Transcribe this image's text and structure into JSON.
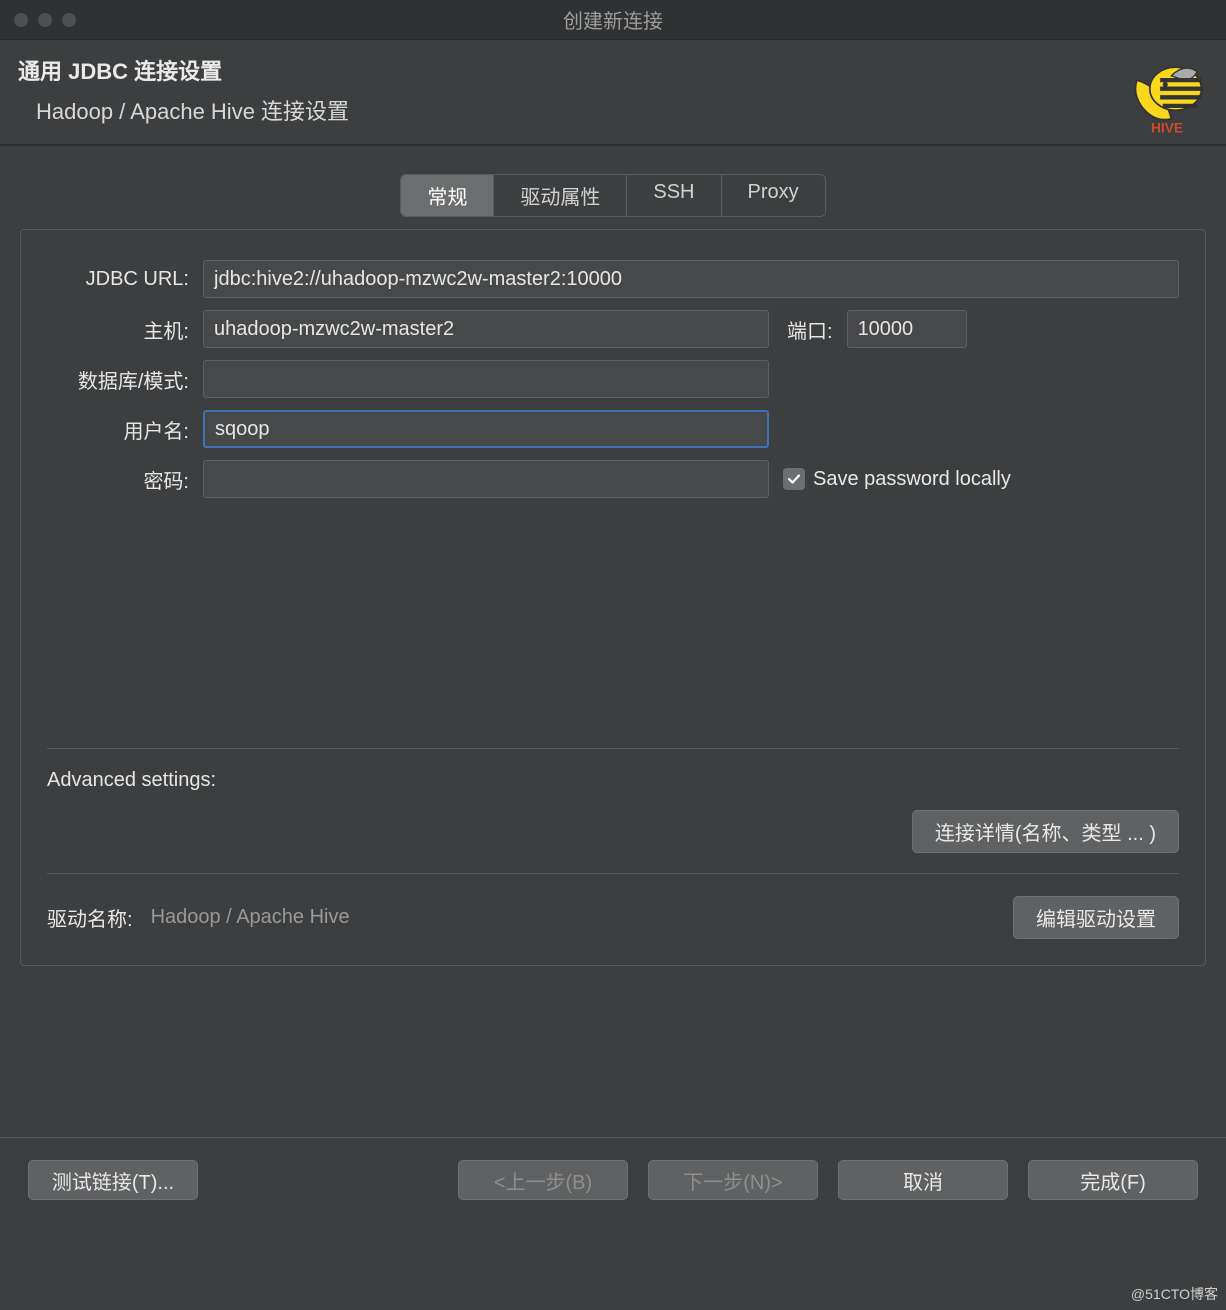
{
  "window": {
    "title": "创建新连接"
  },
  "header": {
    "title": "通用 JDBC 连接设置",
    "subtitle": "Hadoop / Apache Hive 连接设置"
  },
  "tabs": {
    "general": "常规",
    "driver_props": "驱动属性",
    "ssh": "SSH",
    "proxy": "Proxy"
  },
  "form": {
    "jdbc_url_label": "JDBC URL:",
    "jdbc_url_value": "jdbc:hive2://uhadoop-mzwc2w-master2:10000",
    "host_label": "主机:",
    "host_value": "uhadoop-mzwc2w-master2",
    "port_label": "端口:",
    "port_value": "10000",
    "database_label": "数据库/模式:",
    "database_value": "",
    "username_label": "用户名:",
    "username_value": "sqoop",
    "password_label": "密码:",
    "password_value": "",
    "save_pwd_label": "Save password locally",
    "save_pwd_checked": true
  },
  "advanced": {
    "title": "Advanced settings:",
    "conn_details_btn": "连接详情(名称、类型 ... )"
  },
  "driver": {
    "label": "驱动名称:",
    "value": "Hadoop / Apache Hive",
    "edit_btn": "编辑驱动设置"
  },
  "footer": {
    "test": "测试链接(T)...",
    "back": "<上一步(B)",
    "next": "下一步(N)>",
    "cancel": "取消",
    "finish": "完成(F)"
  },
  "watermark": "@51CTO博客"
}
